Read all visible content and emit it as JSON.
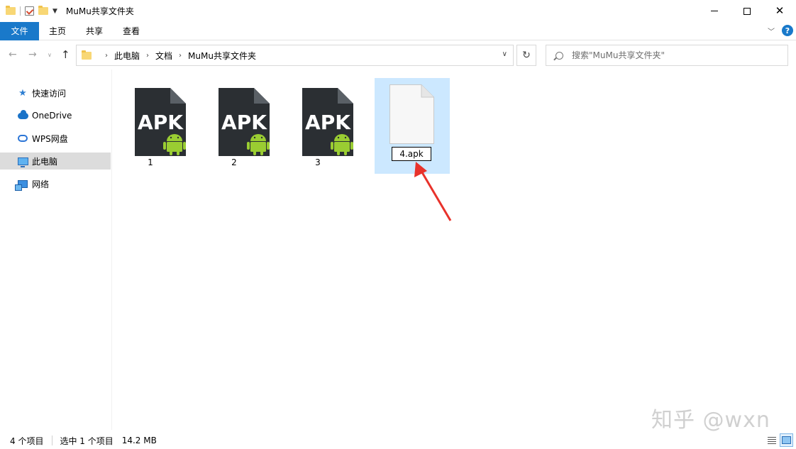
{
  "window": {
    "title": "MuMu共享文件夹"
  },
  "ribbon": {
    "tabs": [
      "文件",
      "主页",
      "共享",
      "查看"
    ],
    "help": "?"
  },
  "nav": {
    "breadcrumbs": [
      "此电脑",
      "文档",
      "MuMu共享文件夹"
    ]
  },
  "search": {
    "placeholder": "搜索\"MuMu共享文件夹\""
  },
  "sidebar": {
    "items": [
      {
        "label": "快速访问",
        "icon": "star-icon"
      },
      {
        "label": "OneDrive",
        "icon": "cloud-icon"
      },
      {
        "label": "WPS网盘",
        "icon": "wps-cloud-icon"
      },
      {
        "label": "此电脑",
        "icon": "computer-icon"
      },
      {
        "label": "网络",
        "icon": "network-icon"
      }
    ]
  },
  "files": [
    {
      "name": "1",
      "icon_text": "APK"
    },
    {
      "name": "2",
      "icon_text": "APK"
    },
    {
      "name": "3",
      "icon_text": "APK"
    },
    {
      "name": "4.apk",
      "renaming": true
    }
  ],
  "status": {
    "count": "4 个项目",
    "selected": "选中 1 个项目",
    "size": "14.2 MB"
  },
  "watermark": "知乎 @wxn",
  "colors": {
    "accent": "#1979ca",
    "selection": "#cce8ff",
    "apk_dark": "#2b2f33",
    "android_green": "#9acd32",
    "arrow_red": "#e8322b"
  }
}
